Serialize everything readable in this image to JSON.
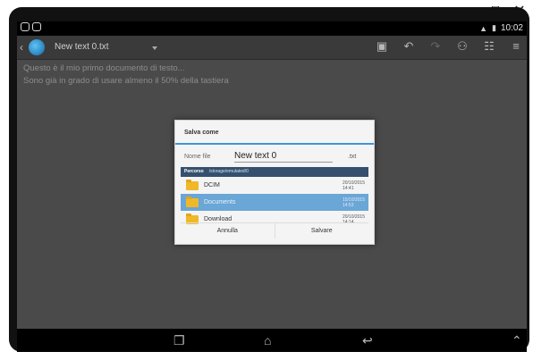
{
  "window": {
    "restore_icon": "restore-icon",
    "close_icon": "close-icon"
  },
  "statusbar": {
    "time": "10:02"
  },
  "appbar": {
    "title": "New text 0.txt"
  },
  "editor": {
    "lines": [
      "Questo è il mio primo documento di testo...",
      "Sono già in grado di usare almeno il 50% della tastiera"
    ]
  },
  "dialog": {
    "title": "Salva come",
    "filename_label": "Nome file",
    "filename_value": "New text 0",
    "extension": ".txt",
    "path_label": "Percorso",
    "path_value": "/storage/emulated/0",
    "folders": [
      {
        "name": "DCIM",
        "date": "20/10/2015",
        "time": "14:41"
      },
      {
        "name": "Documents",
        "date": "15/10/2015",
        "time": "14:53"
      },
      {
        "name": "Download",
        "date": "20/10/2015",
        "time": "14:14"
      }
    ],
    "cancel_label": "Annulla",
    "save_label": "Salvare"
  },
  "colors": {
    "accent": "#3f95d9",
    "selection": "#6aa6d6",
    "path_bar": "#34506e"
  }
}
